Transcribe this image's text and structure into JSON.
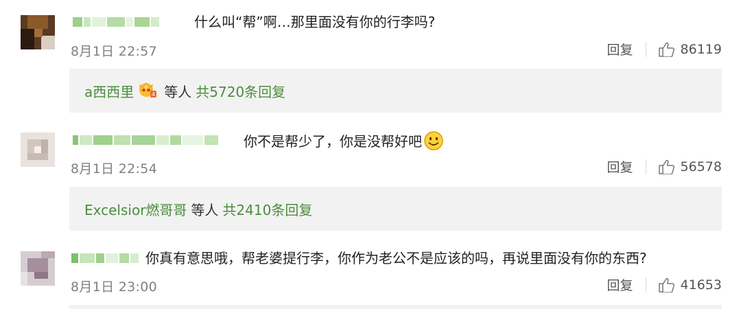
{
  "comments": [
    {
      "content": "什么叫“帮”啊…那里面没有你的行李吗?",
      "time": "8月1日 22:57",
      "reply_label": "回复",
      "likes": "86119",
      "sub_replies": {
        "user": "a西西里",
        "middle": "等人",
        "count_text": "共5720条回复"
      }
    },
    {
      "content": "你不是帮少了，你是没帮好吧",
      "time": "8月1日 22:54",
      "reply_label": "回复",
      "likes": "56578",
      "sub_replies": {
        "user": "Excelsior燃哥哥",
        "middle": "等人",
        "count_text": "共2410条回复"
      }
    },
    {
      "content": "你真有意思哦，帮老婆提行李，你作为老公不是应该的吗，再说里面没有你的东西?",
      "time": "8月1日 23:00",
      "reply_label": "回复",
      "likes": "41653"
    }
  ],
  "colors": {
    "link_green": "#4a8e3c",
    "time_gray": "#808080",
    "subbox_bg": "#f2f2f2"
  },
  "icons": [
    "thumbs-up-icon",
    "smile-emoji-icon",
    "crown-badge-icon"
  ]
}
